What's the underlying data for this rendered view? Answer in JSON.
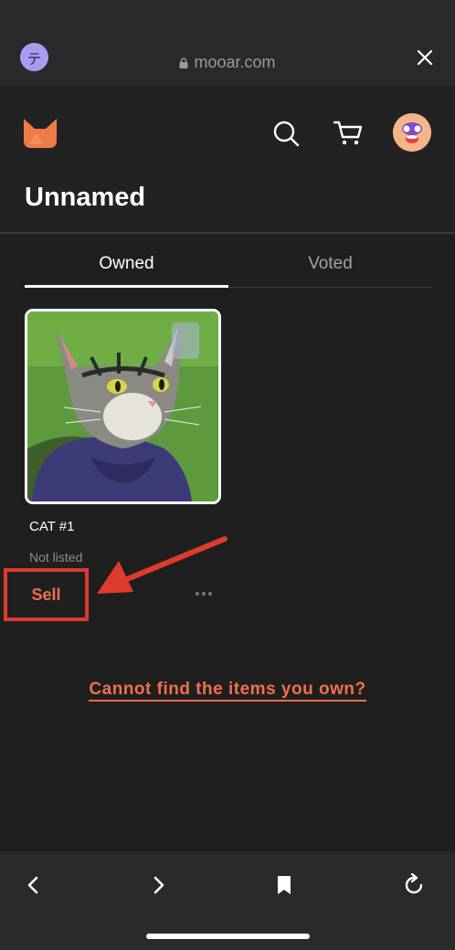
{
  "browser": {
    "site_badge": "テ",
    "url": "mooar.com"
  },
  "header": {
    "title": "Unnamed"
  },
  "tabs": [
    {
      "label": "Owned",
      "active": true
    },
    {
      "label": "Voted",
      "active": false
    }
  ],
  "items": [
    {
      "name": "CAT #1",
      "status": "Not listed",
      "action": "Sell"
    }
  ],
  "footer_link": "Cannot find the items you own?",
  "colors": {
    "accent": "#ef6f4c",
    "annotation": "#e03a2f",
    "background": "#1f1f1f"
  },
  "icons": [
    "lock-icon",
    "close-icon",
    "logo-icon",
    "search-icon",
    "cart-icon",
    "avatar",
    "more-icon",
    "back-icon",
    "forward-icon",
    "bookmark-icon",
    "reload-icon"
  ]
}
